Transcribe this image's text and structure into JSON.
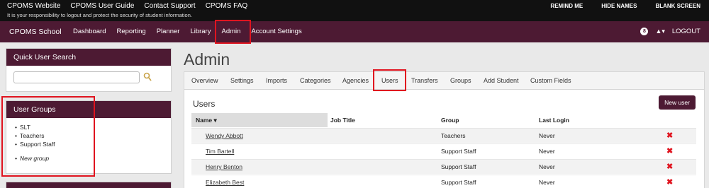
{
  "topbar": {
    "links": [
      "CPOMS Website",
      "CPOMS User Guide",
      "Contact Support",
      "CPOMS FAQ"
    ],
    "notice": "It is your responsibility to logout and protect the security of student information.",
    "right": [
      "REMIND ME",
      "HIDE NAMES",
      "BLANK SCREEN"
    ]
  },
  "navbar": {
    "brand": "CPOMS School",
    "items": [
      "Dashboard",
      "Reporting",
      "Planner",
      "Library",
      "Admin",
      "Account Settings"
    ],
    "badge": "8",
    "logout": "LOGOUT"
  },
  "sidebar": {
    "quick_search": {
      "title": "Quick User Search",
      "placeholder": ""
    },
    "user_groups": {
      "title": "User Groups",
      "items": [
        "SLT",
        "Teachers",
        "Support Staff"
      ],
      "new_group": "New group"
    }
  },
  "main": {
    "title": "Admin",
    "tabs": [
      "Overview",
      "Settings",
      "Imports",
      "Categories",
      "Agencies",
      "Users",
      "Transfers",
      "Groups",
      "Add Student",
      "Custom Fields"
    ],
    "users_heading": "Users",
    "new_user": "New user",
    "columns": [
      "Name ▾",
      "Job Title",
      "Group",
      "Last Login"
    ],
    "rows": [
      {
        "name": "Wendy Abbott",
        "job": "",
        "group": "Teachers",
        "last_login": "Never"
      },
      {
        "name": "Tim Bartell",
        "job": "",
        "group": "Support Staff",
        "last_login": "Never"
      },
      {
        "name": "Henry Benton",
        "job": "",
        "group": "Support Staff",
        "last_login": "Never"
      },
      {
        "name": "Elizabeth Best",
        "job": "",
        "group": "Support Staff",
        "last_login": "Never"
      }
    ],
    "delete_glyph": "✖"
  },
  "colors": {
    "brand": "#4d1a33",
    "highlight": "#e0141f"
  }
}
